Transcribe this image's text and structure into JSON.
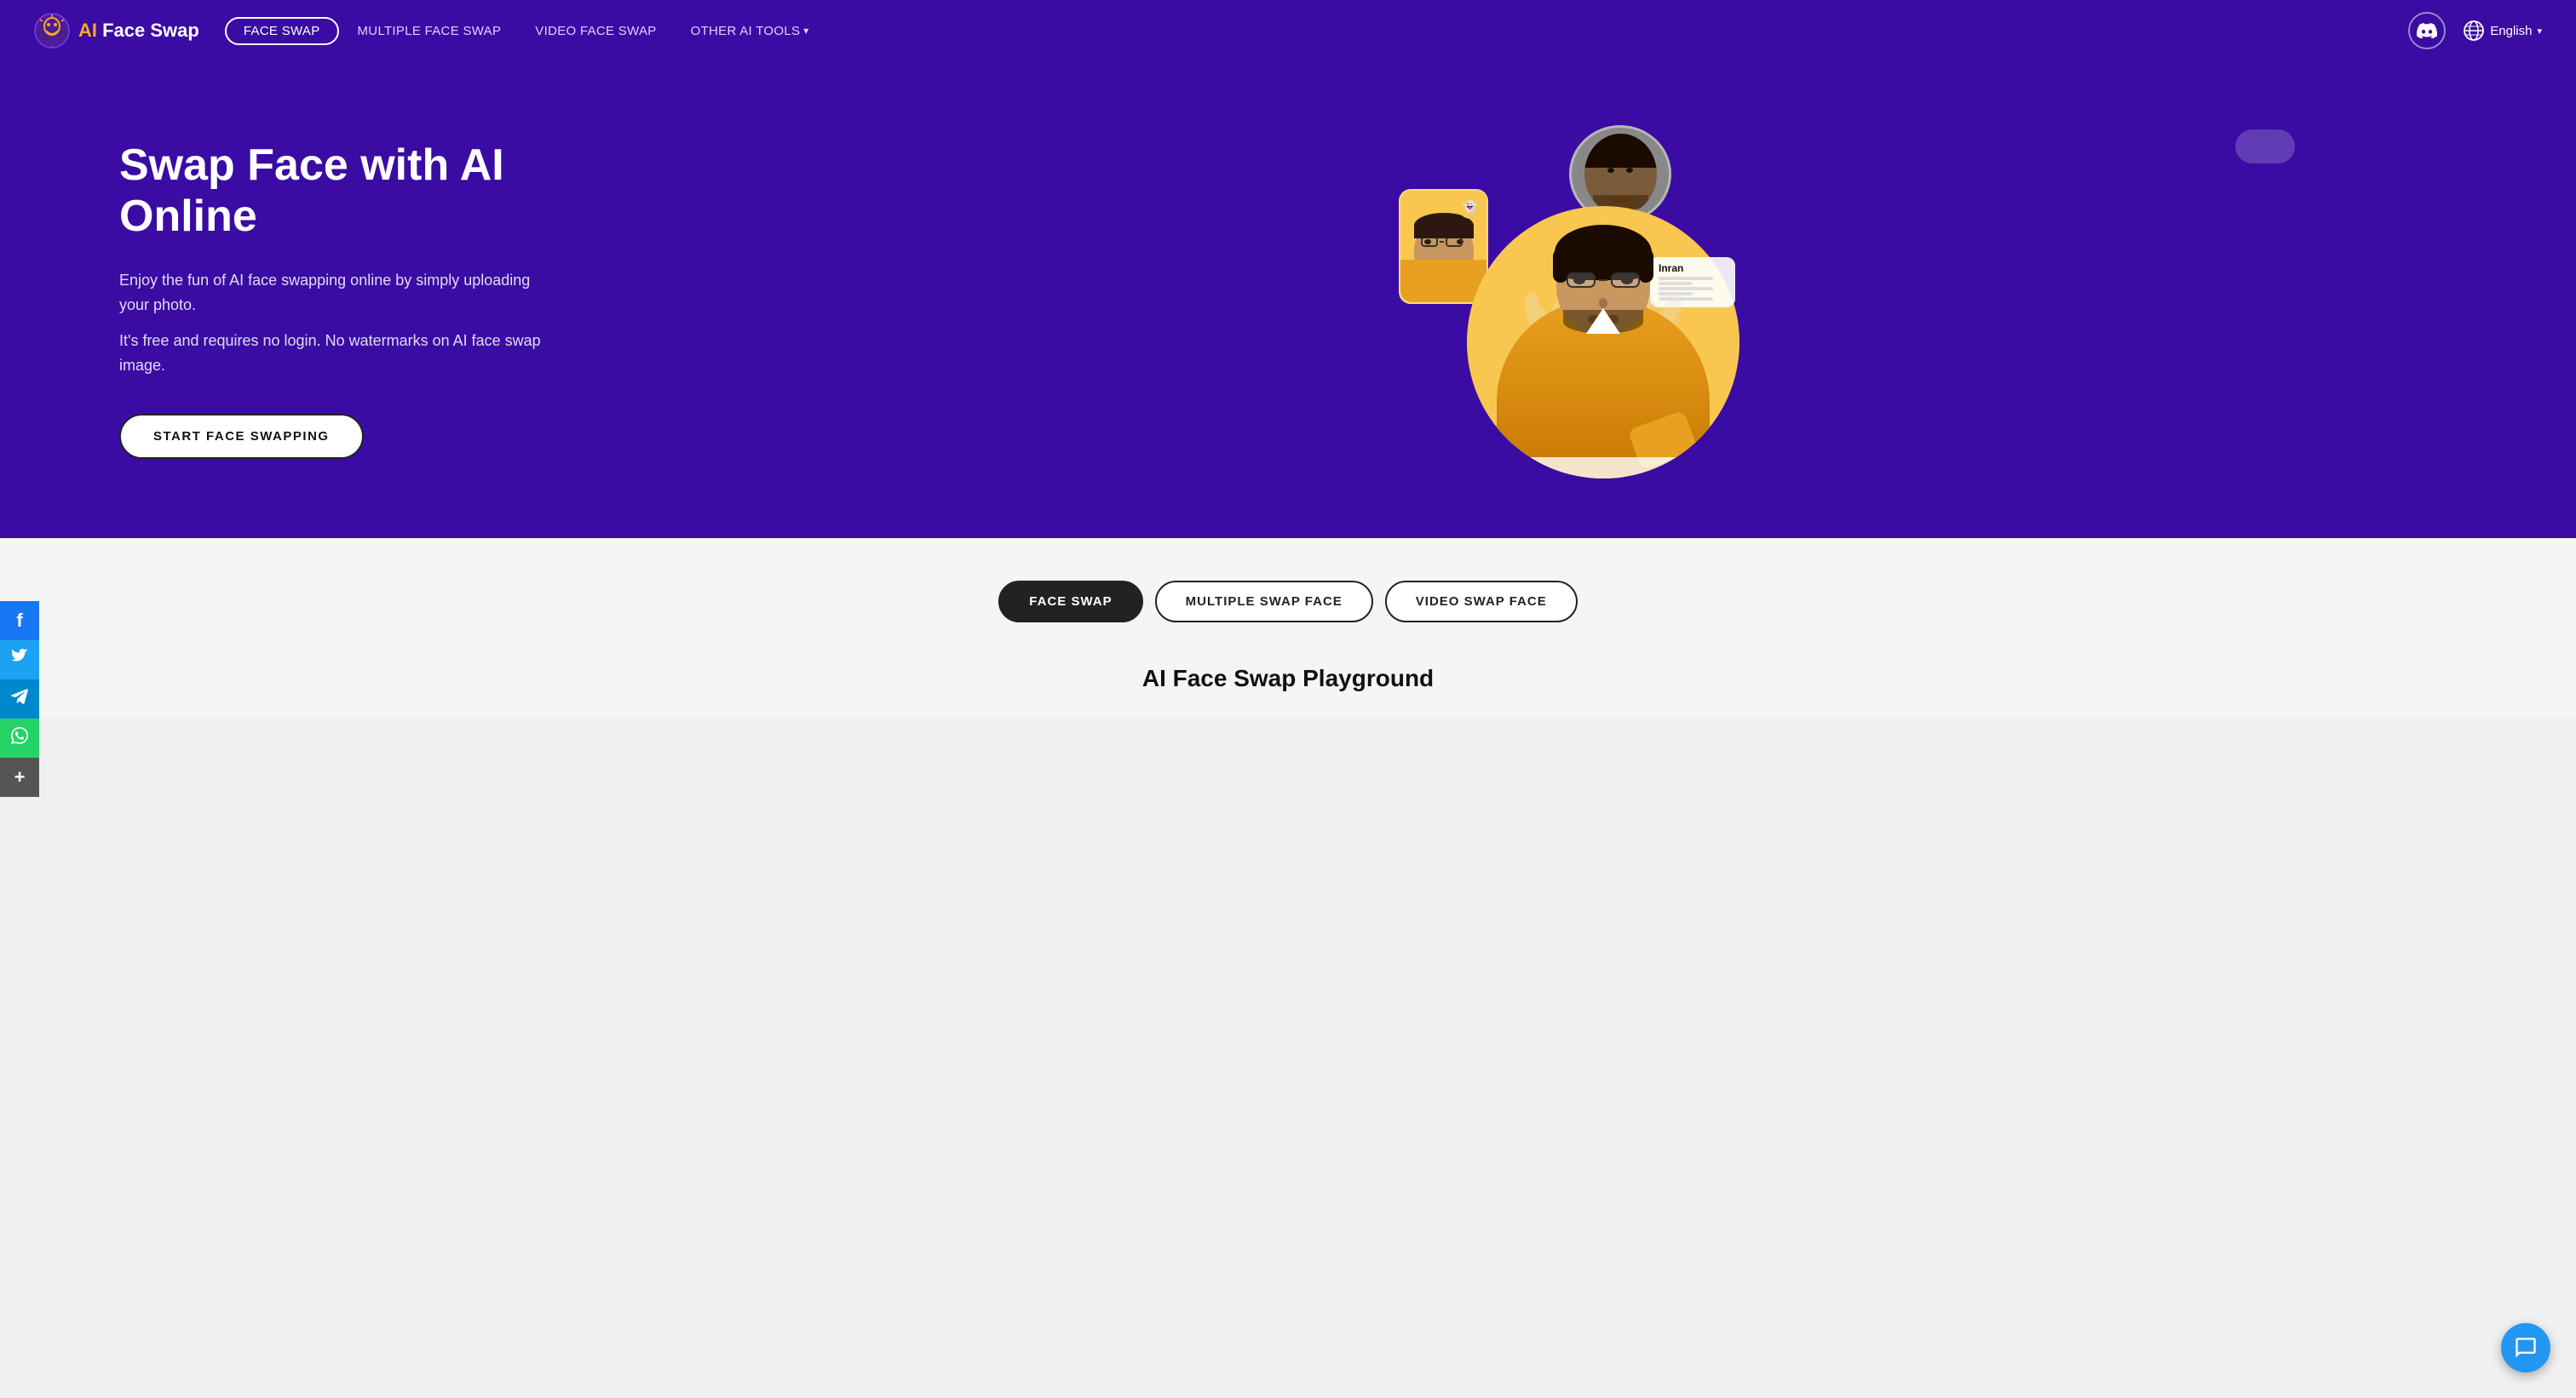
{
  "brand": {
    "name_ai": "AI",
    "name_rest": " Face Swap",
    "logo_alt": "AI Face Swap Logo"
  },
  "nav": {
    "links": [
      {
        "id": "face-swap",
        "label": "FACE SWAP",
        "active": true
      },
      {
        "id": "multiple-face-swap",
        "label": "MULTIPLE FACE SWAP",
        "active": false
      },
      {
        "id": "video-face-swap",
        "label": "VIDEO FACE SWAP",
        "active": false
      },
      {
        "id": "other-ai-tools",
        "label": "OTHER AI TOOLS",
        "active": false,
        "dropdown": true
      }
    ],
    "language": "English",
    "discord_alt": "Discord"
  },
  "hero": {
    "title": "Swap Face with AI Online",
    "desc1": "Enjoy the fun of AI face swapping online by simply uploading your photo.",
    "desc2": "It's free and requires no login. No watermarks on AI face swap image.",
    "cta": "START FACE SWAPPING"
  },
  "social": {
    "buttons": [
      {
        "id": "facebook",
        "label": "f",
        "name": "facebook-icon"
      },
      {
        "id": "twitter",
        "label": "🐦",
        "name": "twitter-icon"
      },
      {
        "id": "telegram",
        "label": "✈",
        "name": "telegram-icon"
      },
      {
        "id": "whatsapp",
        "label": "📱",
        "name": "whatsapp-icon"
      },
      {
        "id": "more",
        "label": "+",
        "name": "more-icon"
      }
    ]
  },
  "lower": {
    "tabs": [
      {
        "id": "face-swap",
        "label": "FACE SWAP",
        "active": true
      },
      {
        "id": "multiple-swap-face",
        "label": "MULTIPLE SWAP FACE",
        "active": false
      },
      {
        "id": "video-swap-face",
        "label": "VIDEO SWAP FACE",
        "active": false
      }
    ],
    "section_title": "AI Face Swap Playground"
  },
  "chat": {
    "icon": "💬",
    "label": "Chat support"
  }
}
